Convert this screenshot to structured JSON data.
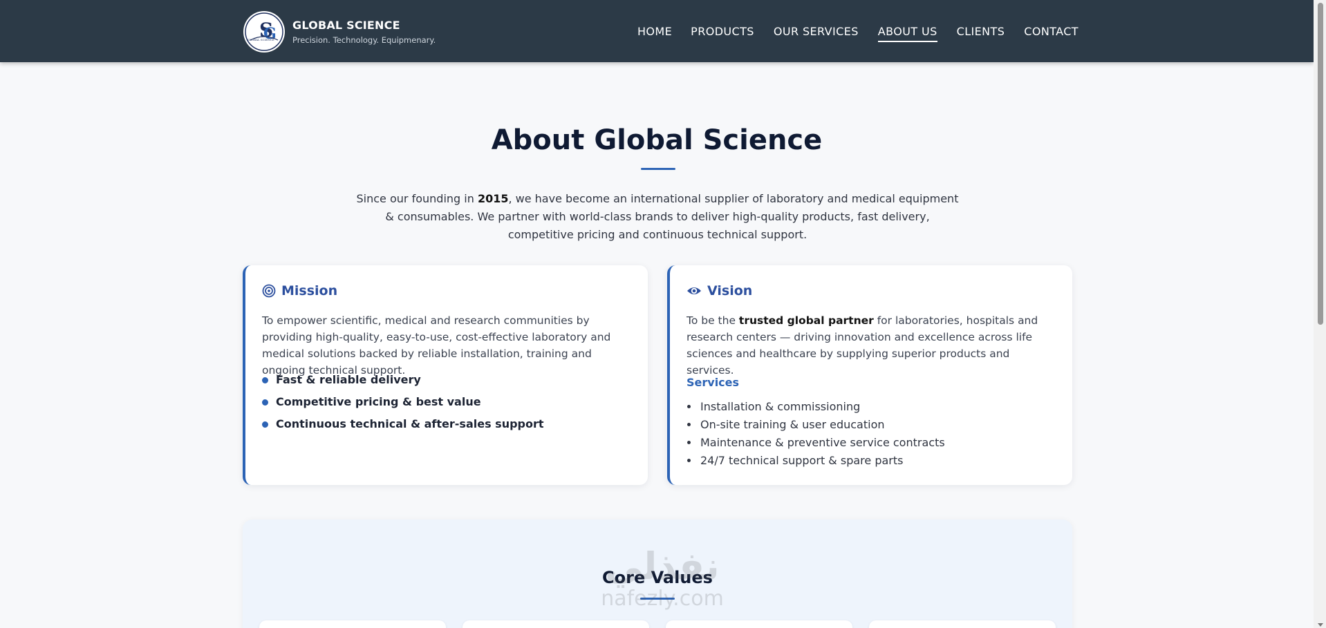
{
  "header": {
    "brand_name": "GLOBAL SCIENCE",
    "tagline": "Precision. Technology. Equipmenary.",
    "logo_text": "GLOBAL SCIENCE",
    "nav": [
      {
        "label": "HOME",
        "active": false
      },
      {
        "label": "PRODUCTS",
        "active": false
      },
      {
        "label": "OUR SERVICES",
        "active": false
      },
      {
        "label": "ABOUT US",
        "active": true
      },
      {
        "label": "CLIENTS",
        "active": false
      },
      {
        "label": "CONTACT",
        "active": false
      }
    ]
  },
  "about": {
    "title": "About Global Science",
    "intro_before": "Since our founding in ",
    "intro_year": "2015",
    "intro_after": ", we have become an international supplier of laboratory and medical equipment & consumables. We partner with world-class brands to deliver high-quality products, fast delivery, competitive pricing and continuous technical support."
  },
  "mission": {
    "icon": "target-icon",
    "title": "Mission",
    "body": "To empower scientific, medical and research communities by providing high-quality, easy-to-use, cost-effective laboratory and medical solutions backed by reliable installation, training and ongoing technical support.",
    "points": [
      "Fast & reliable delivery",
      "Competitive pricing & best value",
      "Continuous technical & after-sales support"
    ]
  },
  "vision": {
    "icon": "eye-icon",
    "title": "Vision",
    "body_before": "To be the ",
    "body_bold": "trusted global partner",
    "body_after": " for laboratories, hospitals and research centers — driving innovation and excellence across life sciences and healthcare by supplying superior products and services.",
    "services_label": "Services",
    "services": [
      "Installation & commissioning",
      "On-site training & user education",
      "Maintenance & preventive service contracts",
      "24/7 technical support & spare parts"
    ]
  },
  "core_values": {
    "title": "Core Values"
  },
  "watermark": {
    "arabic": "نفذلي",
    "latin": "nafezly.com"
  },
  "colors": {
    "header_bg": "#2c3a47",
    "accent": "#2c63b5",
    "heading": "#0f1a33",
    "page_bg": "#f7f8fa"
  }
}
